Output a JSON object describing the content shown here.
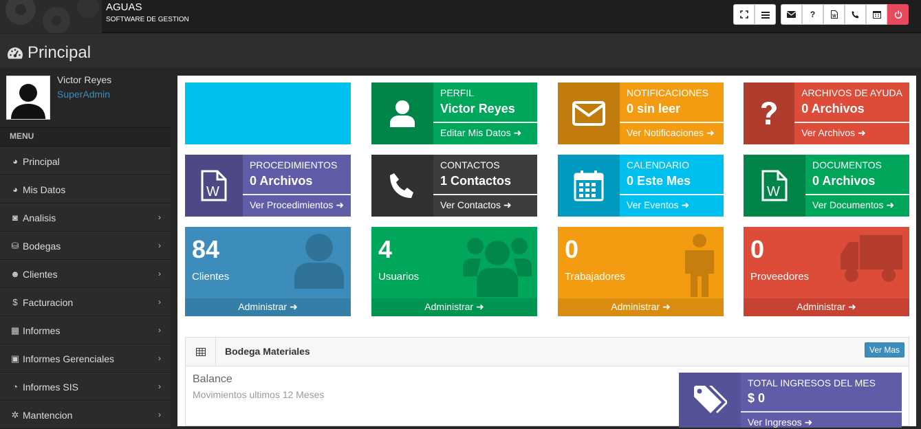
{
  "header": {
    "app_name": "AGUAS",
    "app_subtitle": "SOFTWARE DE GESTION",
    "buttons": [
      {
        "name": "fullscreen-icon",
        "glyph": "⛶"
      },
      {
        "name": "menu-icon",
        "glyph": "≡"
      },
      {
        "name": "mail-icon",
        "glyph": "✉"
      },
      {
        "name": "help-icon",
        "glyph": "?"
      },
      {
        "name": "document-icon",
        "glyph": "🗎"
      },
      {
        "name": "phone-icon",
        "glyph": "✆"
      },
      {
        "name": "calendar-icon",
        "glyph": "▦"
      },
      {
        "name": "power-icon",
        "glyph": "⏻"
      }
    ]
  },
  "page": {
    "title": "Principal"
  },
  "user": {
    "name": "Victor Reyes",
    "role": "SuperAdmin"
  },
  "sidebar": {
    "menu_label": "MENU",
    "items": [
      {
        "label": "Principal",
        "icon": "◕",
        "chevron": false
      },
      {
        "label": "Mis Datos",
        "icon": "◕",
        "chevron": false
      },
      {
        "label": "Analisis",
        "icon": "◙",
        "chevron": true
      },
      {
        "label": "Bodegas",
        "icon": "⛁",
        "chevron": true
      },
      {
        "label": "Clientes",
        "icon": "☻",
        "chevron": true
      },
      {
        "label": "Facturacion",
        "icon": "$",
        "chevron": true
      },
      {
        "label": "Informes",
        "icon": "▦",
        "chevron": true
      },
      {
        "label": "Informes Gerenciales",
        "icon": "▣",
        "chevron": true
      },
      {
        "label": "Informes SIS",
        "icon": "◔",
        "chevron": true
      },
      {
        "label": "Mantencion",
        "icon": "✲",
        "chevron": true
      }
    ]
  },
  "info_boxes": [
    {
      "label": "",
      "value": "",
      "link": "",
      "color": "#00c0ef",
      "icon": "none"
    },
    {
      "label": "PERFIL",
      "value": "Victor Reyes",
      "link": "Editar Mis Datos",
      "color": "#00a65a",
      "icon": "user-icon"
    },
    {
      "label": "NOTIFICACIONES",
      "value": "0 sin leer",
      "link": "Ver Notificaciones",
      "color": "#f39c12",
      "icon": "envelope-icon"
    },
    {
      "label": "ARCHIVOS DE AYUDA",
      "value": "0 Archivos",
      "link": "Ver Archivos",
      "color": "#dd4b39",
      "icon": "question-icon"
    },
    {
      "label": "PROCEDIMIENTOS",
      "value": "0 Archivos",
      "link": "Ver Procedimientos",
      "color": "#605ca8",
      "icon": "word-file-icon"
    },
    {
      "label": "CONTACTOS",
      "value": "1 Contactos",
      "link": "Ver Contactos",
      "color": "#3d3d3d",
      "icon": "phone-icon"
    },
    {
      "label": "CALENDARIO",
      "value": "0 Este Mes",
      "link": "Ver Eventos",
      "color": "#00c0ef",
      "icon": "calendar-icon"
    },
    {
      "label": "DOCUMENTOS",
      "value": "0 Archivos",
      "link": "Ver Documentos",
      "color": "#00a65a",
      "icon": "word-file-icon"
    }
  ],
  "stats": [
    {
      "value": "84",
      "label": "Clientes",
      "footer": "Administrar",
      "color": "#3c8dbc",
      "icon": "person-icon"
    },
    {
      "value": "4",
      "label": "Usuarios",
      "footer": "Administrar",
      "color": "#00a65a",
      "icon": "users-icon"
    },
    {
      "value": "0",
      "label": "Trabajadores",
      "footer": "Administrar",
      "color": "#f39c12",
      "icon": "male-icon"
    },
    {
      "value": "0",
      "label": "Proveedores",
      "footer": "Administrar",
      "color": "#dd4b39",
      "icon": "truck-icon"
    }
  ],
  "panel": {
    "title": "Bodega Materiales",
    "button": "Ver Mas",
    "balance_title": "Balance",
    "balance_subtitle": "Movimientos ultimos 12 Meses",
    "income_label": "TOTAL INGRESOS DEL MES",
    "income_value": "$ 0",
    "income_link": "Ver Ingresos"
  }
}
